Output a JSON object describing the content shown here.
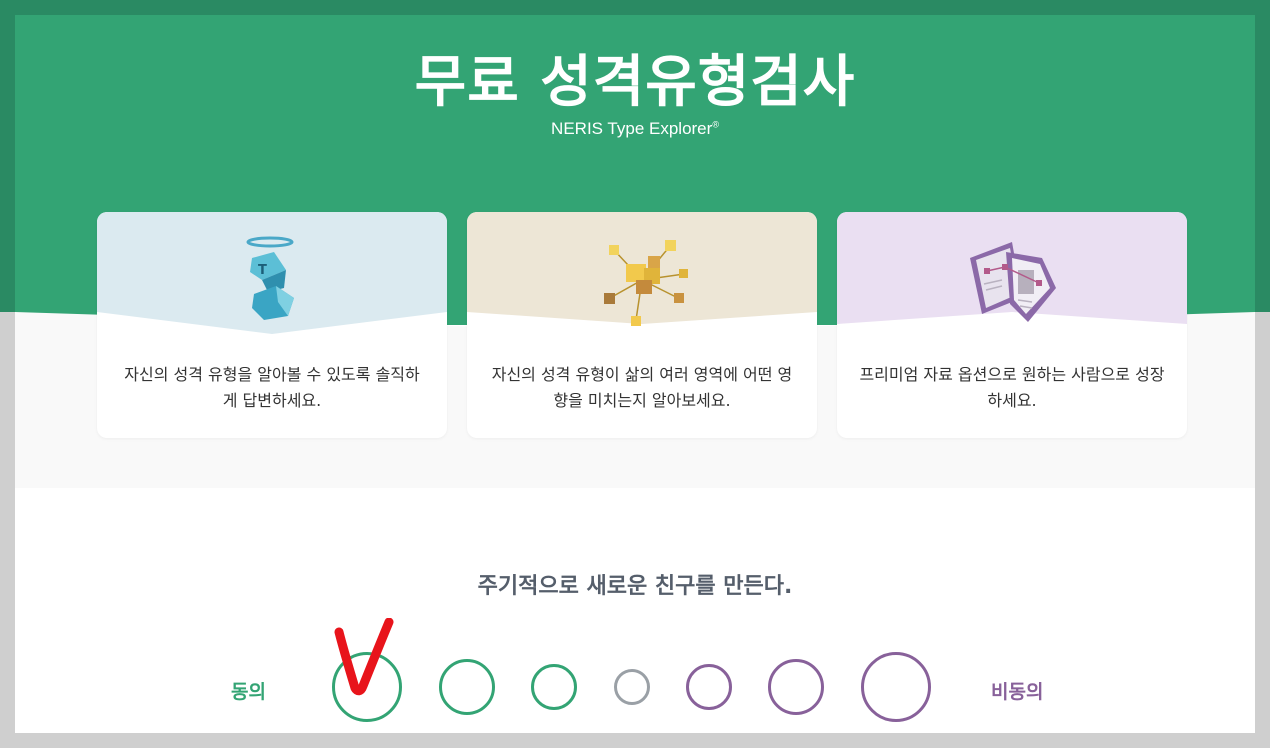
{
  "hero": {
    "title": "무료 성격유형검사",
    "subtitle": "NERIS Type Explorer",
    "subtitle_mark": "®"
  },
  "cards": [
    {
      "text": "자신의 성격 유형을 알아볼 수 있도록 솔직하게 답변하세요.",
      "icon": "floating-cubes-icon",
      "color": "#dbeaf0"
    },
    {
      "text": "자신의 성격 유형이 삶의 여러 영역에 어떤 영향을 미치는지 알아보세요.",
      "icon": "connected-boxes-icon",
      "color": "#ede6d6"
    },
    {
      "text": "프리미엄 자료 옵션으로 원하는 사람으로 성장하세요.",
      "icon": "documents-icon",
      "color": "#eadff2"
    }
  ],
  "question": {
    "text": "주기적으로 새로운 친구를 만든다.",
    "agree_label": "동의",
    "disagree_label": "비동의",
    "options": [
      "strongly-agree",
      "agree",
      "slightly-agree",
      "neutral",
      "slightly-disagree",
      "disagree",
      "strongly-disagree"
    ],
    "selected": "strongly-agree"
  },
  "colors": {
    "agree": "#33a474",
    "disagree": "#88619a",
    "neutral": "#9aa0a6",
    "check": "#e8141b"
  }
}
